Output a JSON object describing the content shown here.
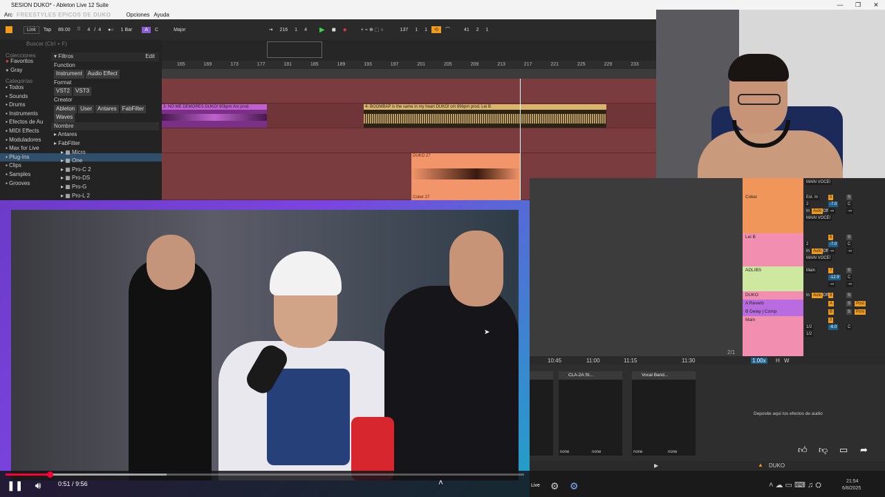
{
  "window": {
    "title": "SESION DUKO* - Ableton Live 12 Suite",
    "overlay_text": "FREESTYLES EPICOS DE DUKO",
    "controls": [
      "—",
      "❐",
      "✕"
    ]
  },
  "menu": {
    "items": [
      "Arc",
      "Opciones",
      "Ayuda"
    ]
  },
  "transport": {
    "link": "Link",
    "tap": "Tap",
    "tempo": "89.00",
    "meter_num": "4",
    "meter_den": "4",
    "quantize": "1 Bar",
    "key": "C",
    "scale": "Major",
    "position": [
      "216",
      "1",
      "4"
    ],
    "loop_start": [
      "137",
      "1",
      "1"
    ],
    "loop_length": [
      "41",
      "2",
      "1"
    ]
  },
  "browser": {
    "search_placeholder": "Buscar (Ctrl + F)",
    "collections_header": "Colecciones",
    "collections": [
      "Favoritos",
      "Gray"
    ],
    "categories_header": "Categorías",
    "categories": [
      "Todos",
      "Sounds",
      "Drums",
      "Instruments",
      "Efectos de Au",
      "MIDI Effects",
      "Moduladores",
      "Max for Live",
      "Plug-Ins",
      "Clips",
      "Samples",
      "Grooves"
    ],
    "selected_category": "Plug-Ins",
    "filters_label": "Filtros",
    "edit_label": "Edit",
    "function_label": "Function",
    "function_tags": [
      "Instrument",
      "Audio Effect"
    ],
    "format_label": "Format",
    "format_tags": [
      "VST2",
      "VST3"
    ],
    "creator_label": "Creator",
    "creator_tags": [
      "Ableton",
      "User",
      "Antares",
      "FabFilter",
      "Waves"
    ],
    "name_header": "Nombre",
    "tree": [
      "Antares",
      "FabFilter",
      "Micro",
      "One",
      "Pro-C 2",
      "Pro-DS",
      "Pro-G",
      "Pro-L 2"
    ]
  },
  "ruler": {
    "bars": [
      "165",
      "169",
      "173",
      "177",
      "181",
      "185",
      "189",
      "193",
      "197",
      "201",
      "205",
      "209",
      "213",
      "217",
      "221",
      "225",
      "229",
      "233"
    ]
  },
  "clips": {
    "clip1": "3- NO ME DEMORES DUKO! 90bpm Am prod.",
    "clip2": "4- BOOMBAP is the same in my heart DUKO! cm 89bpm prod. Lei B",
    "clip3": "DUKO 27",
    "clip4": "Coker 27"
  },
  "mixer": {
    "tracks": [
      {
        "name": "",
        "io": "MAIN VOCE!",
        "num": "",
        "vol": "",
        "color": "#f0965a"
      },
      {
        "name": "Coker",
        "io": "Ext. In",
        "ch": "2",
        "num": "5",
        "vol": "-7.0",
        "pan": "C",
        "out": "MAIN VOCE!",
        "color": "#f0965a"
      },
      {
        "name": "Lei B",
        "io": "",
        "ch": "2",
        "num": "6",
        "vol": "-7.0",
        "pan": "C",
        "out": "MAIN VOCE!",
        "color": "#f28fb0"
      },
      {
        "name": "ADLIBS",
        "io": "Main",
        "num": "7",
        "vol": "-12.9",
        "pan": "C",
        "color": "#cfe8a0"
      },
      {
        "name": "DUKO",
        "io": "",
        "num": "8",
        "vol": "",
        "pan": "",
        "color": "#f28fb0"
      },
      {
        "name": "A Reverb",
        "num": "A",
        "color": "#b96be0"
      },
      {
        "name": "B Delay | Comp",
        "num": "B",
        "color": "#b96be0"
      },
      {
        "name": "Main",
        "ch": "1/2",
        "ch2": "1/2",
        "num": "0",
        "vol": "-6.0",
        "pan": "C",
        "color": "#f28fb0"
      }
    ],
    "in_label": "In",
    "auto_label": "Auto",
    "off_label": "Off",
    "inf": "-∞",
    "s_label": "S",
    "post_label": "Post"
  },
  "timeline": {
    "times": [
      "10:45",
      "11:00",
      "11:15",
      "11:30"
    ],
    "zoom": "1.00x",
    "page": "2/1",
    "h": "H",
    "w": "W"
  },
  "devices": {
    "dev1": "CLA-2A St...",
    "dev2": "Vocal Band...",
    "drop_text": "Deposite aquí los efectos de audio",
    "none": "none",
    "track_name": "DUKO"
  },
  "player": {
    "time_current": "0:51",
    "time_total": "9:56",
    "progress": 0.0856,
    "buffered": 0.31,
    "cursor_hint": "Live"
  },
  "taskbar": {
    "time": "21:54",
    "date": "6/8/2025"
  },
  "colors": {
    "accent": "#f29b1d",
    "track_red": "#7a3c3f",
    "clip_purple": "#c060d0",
    "clip_tan": "#d9b46a",
    "clip_salmon": "#f2956a",
    "yt_red": "#ff0033"
  }
}
